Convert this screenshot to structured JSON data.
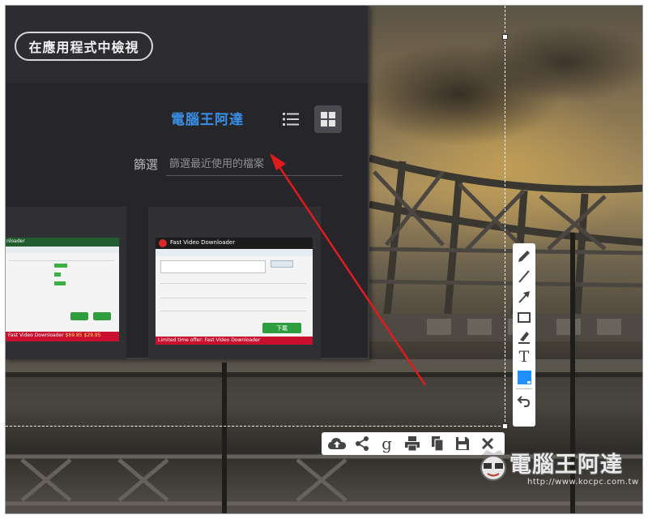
{
  "app": {
    "open_in_app_label": "在應用程式中檢視",
    "user_name": "電腦王阿達",
    "filter_label": "篩選",
    "filter_placeholder": "篩選最近使用的檔案"
  },
  "thumbnails": [
    {
      "app_name": "nloader",
      "promo_text": "Fast Video Downloader",
      "prices": [
        "$69.85",
        "$29.95"
      ]
    },
    {
      "app_name": "Fast Video Downloader",
      "download_button": "下載",
      "promo_text": "Limited time offer: Fast Video Downloader"
    }
  ],
  "drawing_tools": [
    "pencil-tool",
    "line-tool",
    "arrow-tool",
    "rectangle-tool",
    "marker-tool",
    "text-tool",
    "color-picker",
    "undo-tool"
  ],
  "text_tool_label": "T",
  "action_tools": [
    "upload-cloud",
    "share",
    "google-search",
    "print",
    "copy",
    "save",
    "close"
  ],
  "google_glyph": "g",
  "colors": {
    "accent_blue": "#3a8ee6",
    "arrow_red": "#e01b1b",
    "selected_color": "#1e90ff"
  },
  "watermark": {
    "name": "電腦王阿達",
    "url": "http://www.kocpc.com.tw"
  }
}
